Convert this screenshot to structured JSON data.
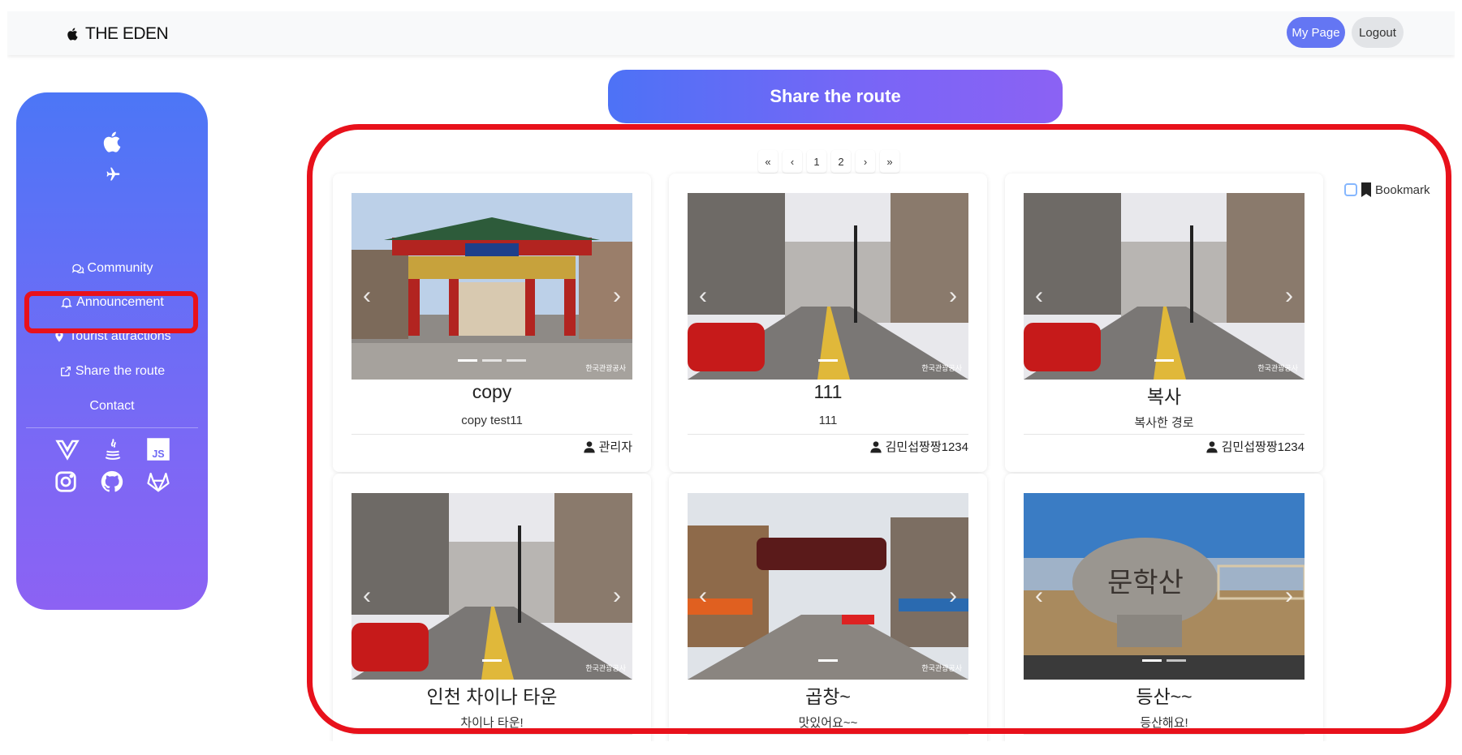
{
  "header": {
    "brand": "THE EDEN",
    "mypage_label": "My Page",
    "logout_label": "Logout"
  },
  "sidebar": {
    "items": [
      {
        "label": "Community",
        "icon": "chat-icon"
      },
      {
        "label": "Announcement",
        "icon": "bell-icon"
      },
      {
        "label": "Tourist attractions",
        "icon": "map-pin-icon"
      },
      {
        "label": "Share the route",
        "icon": "share-icon",
        "active": true
      },
      {
        "label": "Contact",
        "icon": ""
      }
    ],
    "tech_icons": [
      "vue-icon",
      "java-icon",
      "js-icon",
      "instagram-icon",
      "github-icon",
      "gitlab-icon"
    ]
  },
  "main": {
    "title": "Share the route",
    "pagination": [
      "«",
      "‹",
      "1",
      "2",
      "›",
      "»"
    ],
    "bookmark_label": "Bookmark",
    "cards": [
      {
        "title": "copy",
        "desc": "copy test11",
        "author": "관리자",
        "image": "chinatown-gate"
      },
      {
        "title": "111",
        "desc": "111",
        "author": "김민섭짱짱1234",
        "image": "street"
      },
      {
        "title": "복사",
        "desc": "복사한 경로",
        "author": "김민섭짱짱1234",
        "image": "street"
      },
      {
        "title": "인천 차이나 타운",
        "desc": "차이나 타운!",
        "author": "",
        "image": "street"
      },
      {
        "title": "곱창~",
        "desc": "맛있어요~~",
        "author": "",
        "image": "market"
      },
      {
        "title": "등산~~",
        "desc": "등산해요!",
        "author": "",
        "image": "mountain-stone"
      }
    ],
    "watermark": "한국관광공사",
    "stone_text": "문학산"
  },
  "colors": {
    "accent": "#6476f3",
    "sidebar_top": "#4c76f6",
    "sidebar_bottom": "#8c62f3",
    "highlight": "#e8111b"
  }
}
